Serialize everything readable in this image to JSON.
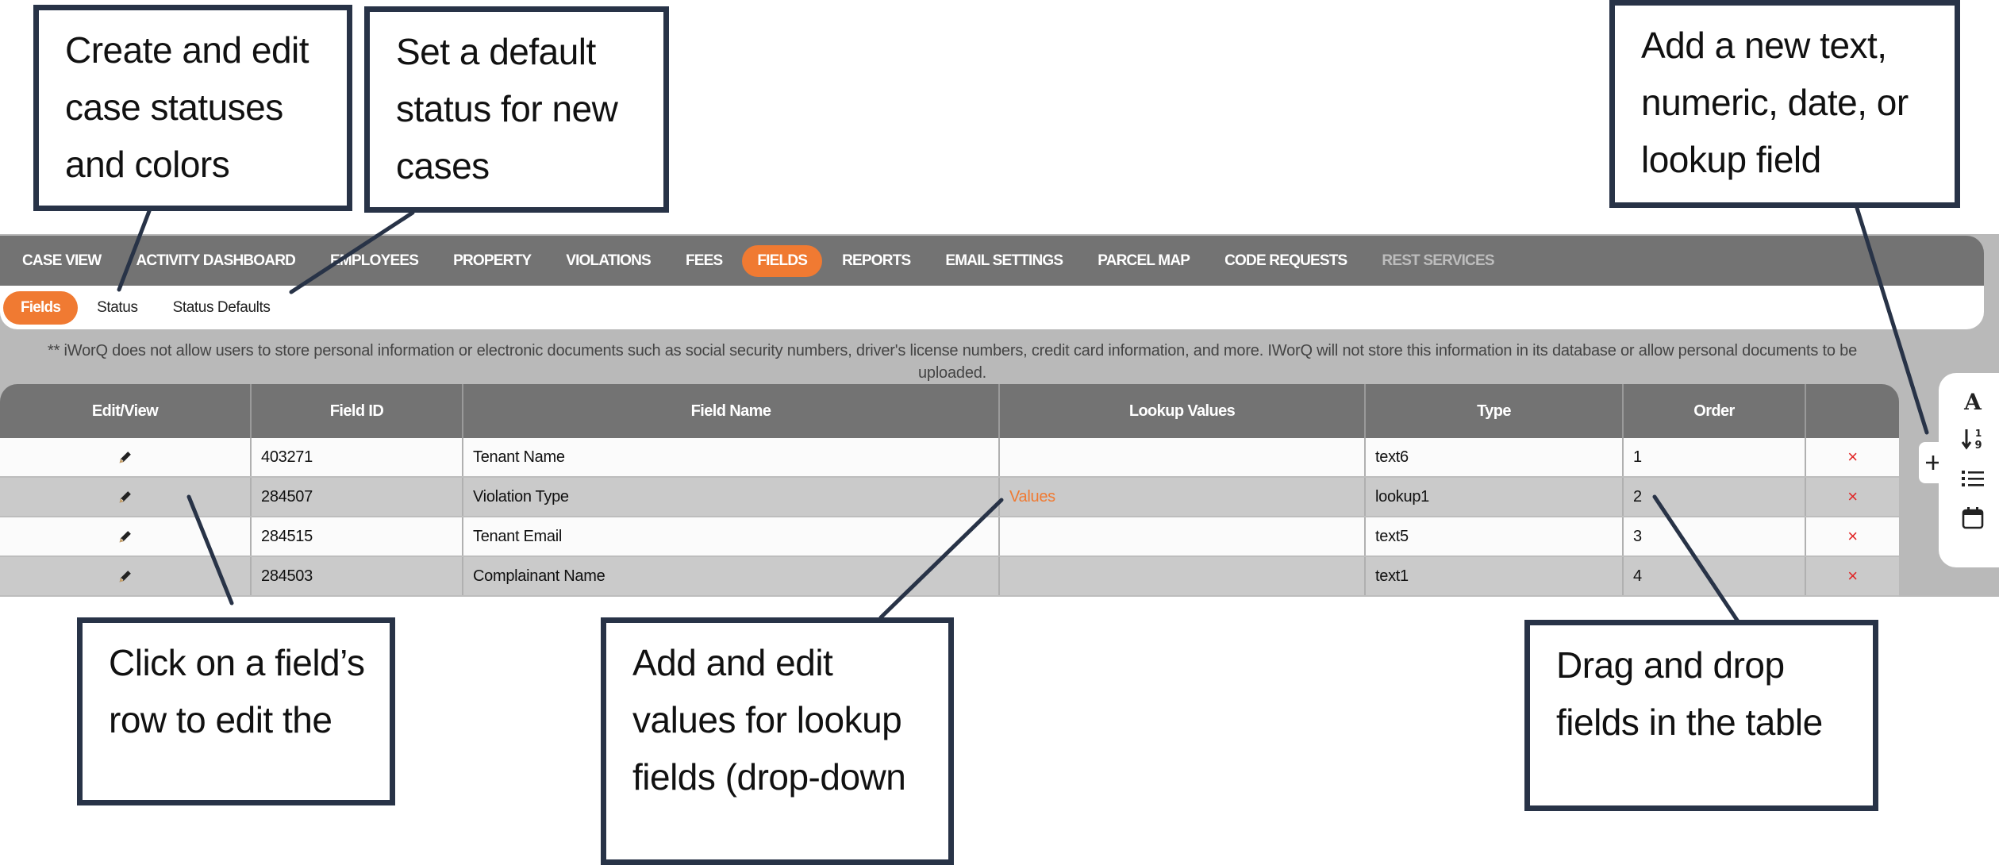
{
  "nav": {
    "items": [
      {
        "label": "CASE VIEW",
        "state": "normal"
      },
      {
        "label": "ACTIVITY DASHBOARD",
        "state": "normal"
      },
      {
        "label": "EMPLOYEES",
        "state": "normal"
      },
      {
        "label": "PROPERTY",
        "state": "normal"
      },
      {
        "label": "VIOLATIONS",
        "state": "normal"
      },
      {
        "label": "FEES",
        "state": "normal"
      },
      {
        "label": "FIELDS",
        "state": "active"
      },
      {
        "label": "REPORTS",
        "state": "normal"
      },
      {
        "label": "EMAIL SETTINGS",
        "state": "normal"
      },
      {
        "label": "PARCEL MAP",
        "state": "normal"
      },
      {
        "label": "CODE REQUESTS",
        "state": "normal"
      },
      {
        "label": "REST SERVICES",
        "state": "disabled"
      }
    ]
  },
  "subnav": {
    "items": [
      {
        "label": "Fields",
        "state": "active"
      },
      {
        "label": "Status",
        "state": "normal"
      },
      {
        "label": "Status Defaults",
        "state": "normal"
      }
    ]
  },
  "notice": "** iWorQ does not allow users to store personal information or electronic documents such as social security numbers, driver's license numbers, credit card information, and more. IWorQ will not store this information in its database or allow personal documents to be uploaded.",
  "table": {
    "headers": [
      "Edit/View",
      "Field ID",
      "Field Name",
      "Lookup Values",
      "Type",
      "Order",
      ""
    ],
    "rows": [
      {
        "field_id": "403271",
        "field_name": "Tenant Name",
        "lookup": "",
        "type": "text6",
        "order": "1"
      },
      {
        "field_id": "284507",
        "field_name": "Violation Type",
        "lookup": "Values",
        "type": "lookup1",
        "order": "2"
      },
      {
        "field_id": "284515",
        "field_name": "Tenant Email",
        "lookup": "",
        "type": "text5",
        "order": "3"
      },
      {
        "field_id": "284503",
        "field_name": "Complainant Name",
        "lookup": "",
        "type": "text1",
        "order": "4"
      }
    ],
    "delete_glyph": "×",
    "edit_icon": "pencil-icon"
  },
  "add_field": {
    "button_glyph": "+",
    "menu": [
      {
        "icon": "text-field-icon",
        "glyph": "A"
      },
      {
        "icon": "numeric-field-icon",
        "glyph": "↓19"
      },
      {
        "icon": "lookup-field-icon",
        "glyph": "list"
      },
      {
        "icon": "date-field-icon",
        "glyph": "calendar"
      }
    ]
  },
  "callouts": {
    "status": [
      "Create and edit",
      "case statuses",
      "and colors"
    ],
    "status_defaults": [
      "Set a default",
      "status for new",
      "cases"
    ],
    "add_field": [
      "Add a new text,",
      "numeric, date, or",
      "lookup field"
    ],
    "edit_row": [
      "Click on a field’s",
      "row to edit the"
    ],
    "lookup_values": [
      "Add and edit",
      "values for lookup",
      "fields (drop-down"
    ],
    "drag_drop": [
      "Drag and drop",
      "fields in the table"
    ]
  },
  "colors": {
    "accent": "#f07a32",
    "nav_bg": "#737373",
    "band_bg": "#b9b9b9",
    "delete": "#e02424",
    "callout_border": "#283347"
  }
}
